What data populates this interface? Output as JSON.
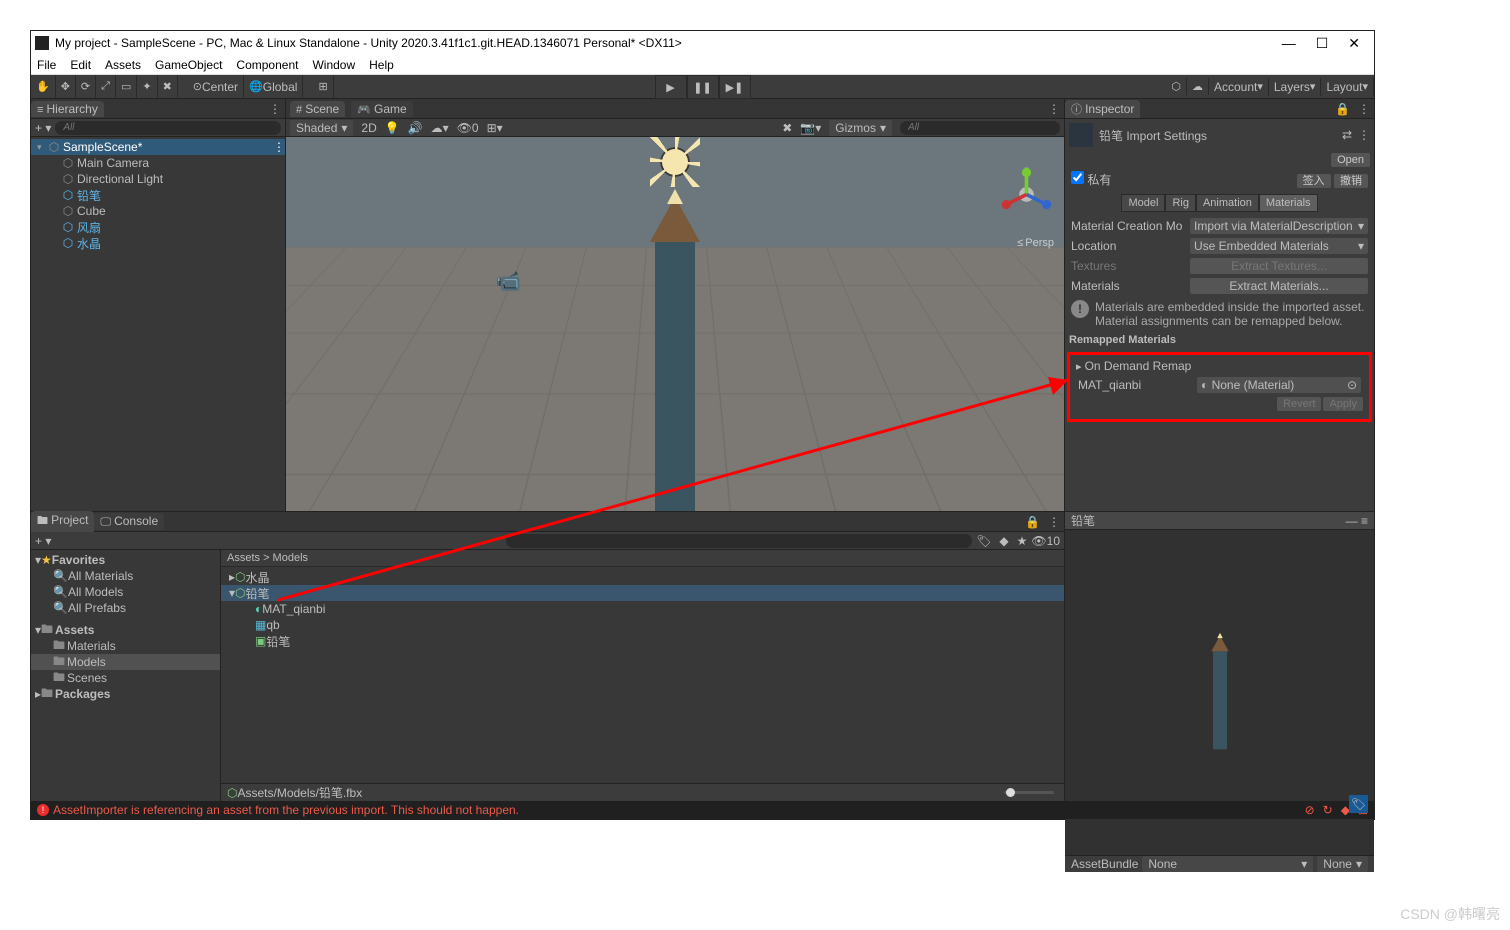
{
  "window_title": "My project - SampleScene - PC, Mac & Linux Standalone - Unity 2020.3.41f1c1.git.HEAD.1346071 Personal* <DX11>",
  "menubar": [
    "File",
    "Edit",
    "Assets",
    "GameObject",
    "Component",
    "Window",
    "Help"
  ],
  "toolbar": {
    "pivot": "Center",
    "space": "Global",
    "account": "Account",
    "layers": "Layers",
    "layout": "Layout"
  },
  "hierarchy": {
    "tab": "Hierarchy",
    "search_placeholder": "All",
    "scene": "SampleScene*",
    "items": [
      {
        "label": "Main Camera",
        "blue": false
      },
      {
        "label": "Directional Light",
        "blue": false
      },
      {
        "label": "铅笔",
        "blue": true
      },
      {
        "label": "Cube",
        "blue": false
      },
      {
        "label": "风扇",
        "blue": true
      },
      {
        "label": "水晶",
        "blue": true
      }
    ]
  },
  "scene": {
    "tab_scene": "Scene",
    "tab_game": "Game",
    "draw_mode": "Shaded",
    "mode_2d": "2D",
    "gizmos": "Gizmos",
    "search_placeholder": "All",
    "persp": "Persp"
  },
  "inspector": {
    "tab": "Inspector",
    "asset_name": "铅笔 Import Settings",
    "open": "Open",
    "private": "私有",
    "signin": "签入",
    "revoke": "撤销",
    "tabs": {
      "model": "Model",
      "rig": "Rig",
      "animation": "Animation",
      "materials": "Materials"
    },
    "mat_creation_lbl": "Material Creation Mo",
    "mat_creation_val": "Import via MaterialDescription",
    "location_lbl": "Location",
    "location_val": "Use Embedded Materials",
    "textures_lbl": "Textures",
    "extract_tex": "Extract Textures...",
    "materials_lbl": "Materials",
    "extract_mat": "Extract Materials...",
    "info1": "Materials are embedded inside the imported asset.",
    "info2": "Material assignments can be remapped below.",
    "remapped": "Remapped Materials",
    "on_demand": "On Demand Remap",
    "mat_name": "MAT_qianbi",
    "mat_val": "None (Material)",
    "revert": "Revert",
    "apply": "Apply"
  },
  "project": {
    "tab_project": "Project",
    "tab_console": "Console",
    "search_placeholder": "",
    "hidden_count": "10",
    "favs": "Favorites",
    "fav_items": [
      "All Materials",
      "All Models",
      "All Prefabs"
    ],
    "assets": "Assets",
    "folders": [
      "Materials",
      "Models",
      "Scenes"
    ],
    "packages": "Packages",
    "crumbs": "Assets > Models",
    "items": [
      {
        "label": "水晶",
        "icon": "cube",
        "indent": 1
      },
      {
        "label": "铅笔",
        "icon": "cube",
        "indent": 1,
        "sel": true
      },
      {
        "label": "MAT_qianbi",
        "icon": "mat",
        "indent": 2
      },
      {
        "label": "qb",
        "icon": "mesh",
        "indent": 2
      },
      {
        "label": "铅笔",
        "icon": "prefab",
        "indent": 2
      }
    ],
    "foot": "Assets/Models/铅笔.fbx"
  },
  "preview": {
    "title": "铅笔",
    "ab_label": "AssetBundle",
    "ab_val": "None",
    "ab_variant": "None"
  },
  "status": "AssetImporter is referencing an asset from the previous import. This should not happen.",
  "watermark": "CSDN @韩曙亮"
}
